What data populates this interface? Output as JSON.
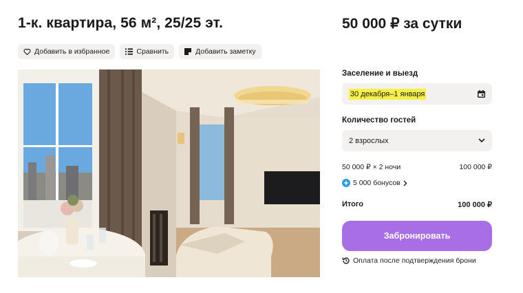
{
  "listing": {
    "title": "1-к. квартира, 56 м², 25/25 эт.",
    "price": "50 000 ₽ за сутки"
  },
  "actions": {
    "favorite_label": "Добавить в избранное",
    "compare_label": "Сравнить",
    "note_label": "Добавить заметку"
  },
  "booking": {
    "dates_label": "Заселение и выезд",
    "dates_value": "30 декабря–1 января",
    "guests_label": "Количество гостей",
    "guests_value": "2 взрослых",
    "calc_label": "50 000 ₽ × 2 ночи",
    "calc_value": "100 000 ₽",
    "bonus_text": "5 000 бонусов",
    "total_label": "Итого",
    "total_value": "100 000 ₽",
    "book_button": "Забронировать",
    "payment_note": "Оплата после подтверждения брони"
  },
  "colors": {
    "accent": "#a86ee6",
    "highlight": "#f5f04a",
    "field_bg": "#f2f1f0",
    "bonus": "#2a9be8"
  },
  "icons": {
    "favorite": "heart-icon",
    "compare": "compare-icon",
    "note": "note-icon",
    "calendar": "calendar-icon",
    "dropdown": "chevron-down-icon",
    "bonus": "bonus-icon",
    "bonus_more": "chevron-right-icon",
    "payment": "clock-refresh-icon"
  }
}
